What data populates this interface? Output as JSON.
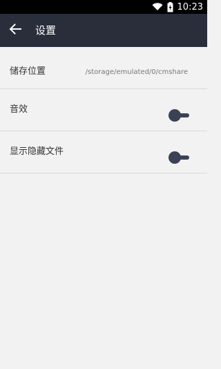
{
  "status_bar": {
    "time": "10:23"
  },
  "header": {
    "title": "设置"
  },
  "settings": [
    {
      "label": "储存位置",
      "value": "/storage/emulated/0/cmshare"
    },
    {
      "label": "音效",
      "toggle_on": false
    },
    {
      "label": "显示隐藏文件",
      "toggle_on": false
    }
  ],
  "colors": {
    "status_bar": "#000000",
    "app_bar": "#2a2d3a",
    "background": "#f2f2f2",
    "toggle": "#3b4256",
    "divider": "#d9d9d9"
  },
  "icons": {
    "back": "arrow-left-icon",
    "wifi": "wifi-icon",
    "battery": "battery-charging-icon"
  }
}
